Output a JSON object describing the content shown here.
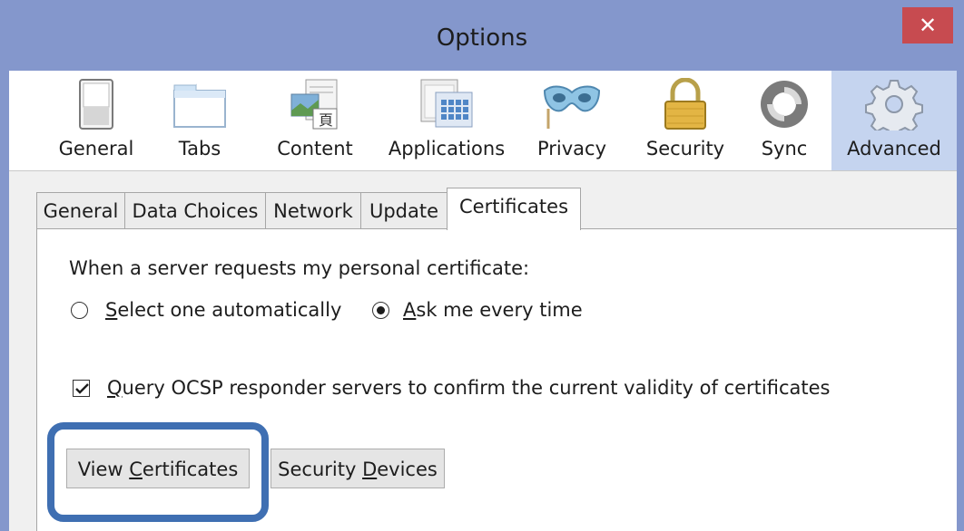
{
  "window": {
    "title": "Options",
    "close_glyph": "✕"
  },
  "toolbar": {
    "items": [
      {
        "label": "General",
        "icon": "switch-icon"
      },
      {
        "label": "Tabs",
        "icon": "tabs-icon"
      },
      {
        "label": "Content",
        "icon": "content-icon"
      },
      {
        "label": "Applications",
        "icon": "applications-icon"
      },
      {
        "label": "Privacy",
        "icon": "mask-icon"
      },
      {
        "label": "Security",
        "icon": "padlock-icon"
      },
      {
        "label": "Sync",
        "icon": "sync-icon"
      },
      {
        "label": "Advanced",
        "icon": "gear-icon",
        "selected": true
      }
    ]
  },
  "subtabs": {
    "items": [
      {
        "label": "General"
      },
      {
        "label": "Data Choices"
      },
      {
        "label": "Network"
      },
      {
        "label": "Update"
      },
      {
        "label": "Certificates",
        "active": true
      }
    ]
  },
  "certificates": {
    "request_label": "When a server requests my personal certificate:",
    "option_auto": {
      "accel": "S",
      "rest": "elect one automatically",
      "selected": false
    },
    "option_ask": {
      "accel": "A",
      "rest": "sk me every time",
      "selected": true
    },
    "ocsp": {
      "accel": "Q",
      "rest": "uery OCSP responder servers to confirm the current validity of certificates",
      "checked": true
    },
    "view_button": {
      "pre": "View ",
      "accel": "C",
      "rest": "ertificates"
    },
    "devices_button": {
      "pre": "Security ",
      "accel": "D",
      "rest": "evices"
    }
  },
  "colors": {
    "titlebar": "#8497cc",
    "close": "#c74b50",
    "selected_tool": "#c5d4ef",
    "highlight": "#3f6fb2"
  }
}
